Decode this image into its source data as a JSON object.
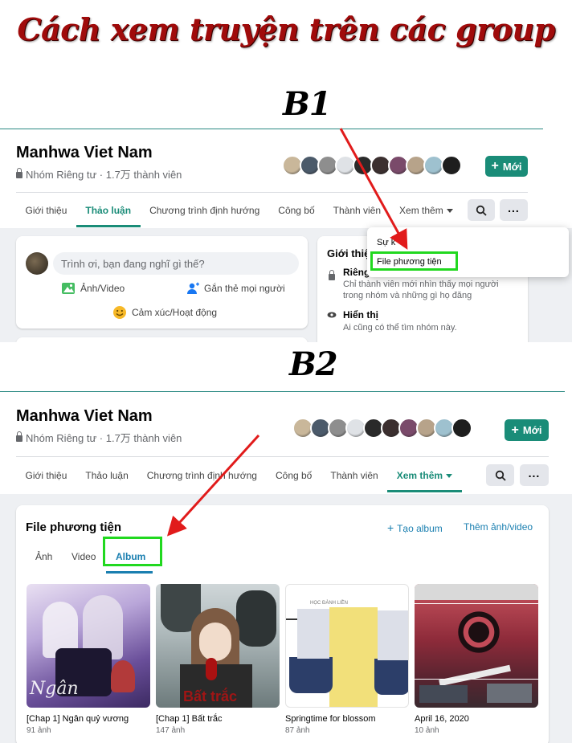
{
  "headline": "Cách xem truyện trên các group",
  "steps": {
    "b1": "B1",
    "b2": "B2"
  },
  "group": {
    "name": "Manhwa Viet Nam",
    "meta": "Nhóm Riêng tư · 1.7万 thành viên",
    "new_button": "Mới",
    "avatar_colors": [
      "#c9b79a",
      "#4b5a6a",
      "#8e8e8e",
      "#dfe2e6",
      "#2a2a2a",
      "#3b2f2f",
      "#7a4a6a",
      "#b7a38a",
      "#9ec1cf",
      "#1e1e1e"
    ]
  },
  "tabs_b1": [
    "Giới thiệu",
    "Thảo luận",
    "Chương trình định hướng",
    "Công bố",
    "Thành viên",
    "Xem thêm"
  ],
  "tabs_b2": [
    "Giới thiệu",
    "Thảo luận",
    "Chương trình định hướng",
    "Công bố",
    "Thành viên",
    "Xem thêm"
  ],
  "composer": {
    "placeholder": "Trình ơi, bạn đang nghĩ gì thế?",
    "photo_video": "Ảnh/Video",
    "tag_people": "Gắn thẻ mọi người",
    "feeling": "Cảm xúc/Hoạt động"
  },
  "about": {
    "title": "Giới thiệ",
    "private_title": "Riêng",
    "private_desc_1": "Chỉ thành viên mới nhìn thấy mọi người",
    "private_desc_2": "trong nhóm và những gì họ đăng",
    "visible_title": "Hiển thị",
    "visible_desc": "Ai cũng có thể tìm nhóm này."
  },
  "dropdown": {
    "item_partial": "Sự k",
    "media_files": "File phương tiện"
  },
  "media": {
    "title": "File phương tiện",
    "create_album": "Tạo album",
    "add_photo_video": "Thêm ảnh/video",
    "tabs": [
      "Ảnh",
      "Video",
      "Album"
    ],
    "albums": [
      {
        "name": "[Chap 1] Ngân quỷ vương",
        "count": "91 ảnh"
      },
      {
        "name": "[Chap 1] Bất trắc",
        "count": "147 ảnh"
      },
      {
        "name": "Springtime for blossom",
        "count": "87 ảnh"
      },
      {
        "name": "April 16, 2020",
        "count": "10 ảnh"
      }
    ]
  },
  "colors": {
    "accent": "#1a8c78",
    "highlight": "#21d81f",
    "arrow": "#e11b1b"
  }
}
